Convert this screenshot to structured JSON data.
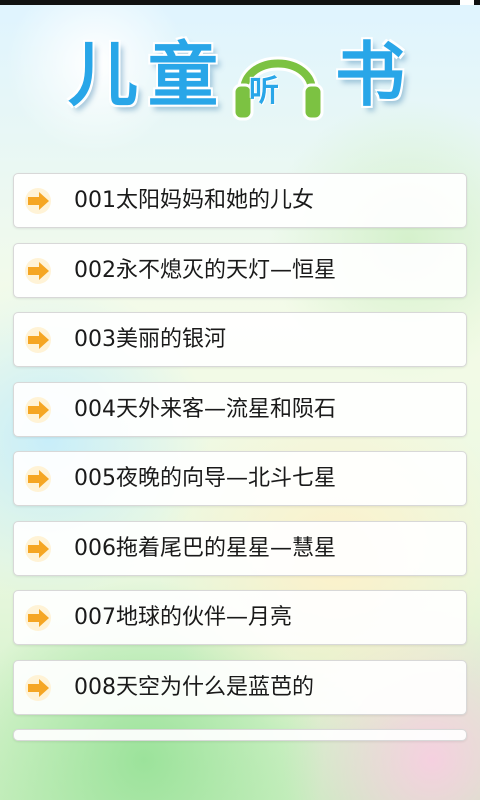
{
  "header": {
    "title_chars": [
      "儿",
      "童",
      "听",
      "书"
    ]
  },
  "list": {
    "items": [
      {
        "label": "001太阳妈妈和她的儿女"
      },
      {
        "label": "002永不熄灭的天灯—恒星"
      },
      {
        "label": "003美丽的银河"
      },
      {
        "label": "004天外来客—流星和陨石"
      },
      {
        "label": "005夜晚的向导—北斗七星"
      },
      {
        "label": "006拖着尾巴的星星—慧星"
      },
      {
        "label": "007地球的伙伴—月亮"
      },
      {
        "label": "008天空为什么是蓝芭的"
      }
    ],
    "arrow_icon": "arrow-right-icon",
    "arrow_color": "#f5a623"
  },
  "colors": {
    "title": "#29a6e8",
    "headphone": "#7cc242"
  }
}
